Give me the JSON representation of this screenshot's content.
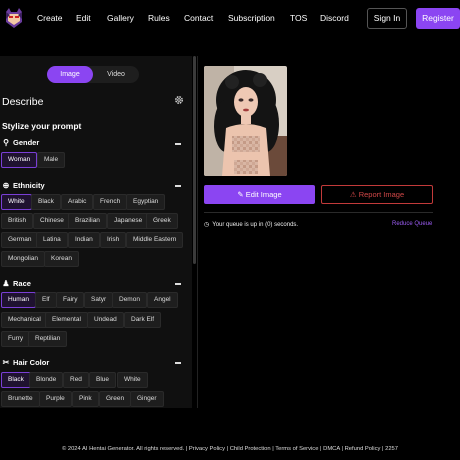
{
  "nav": {
    "links": [
      "Create",
      "Edit",
      "Gallery",
      "Rules",
      "Contact",
      "Subscription",
      "TOS",
      "Discord"
    ],
    "signin": "Sign In",
    "register": "Register"
  },
  "mode_toggle": {
    "image": "Image",
    "video": "Video"
  },
  "panel": {
    "title": "Describe",
    "subtitle": "Stylize your prompt"
  },
  "sections": {
    "gender": {
      "title": "Gender",
      "options": [
        "Woman",
        "Male"
      ],
      "selected": "Woman"
    },
    "ethnicity": {
      "title": "Ethnicity",
      "options": [
        "White",
        "Black",
        "Arabic",
        "French",
        "Egyptian",
        "British",
        "Chinese",
        "Brazilian",
        "Japanese",
        "Greek",
        "German",
        "Latina",
        "Indian",
        "Irish",
        "Middle Eastern",
        "Mongolian",
        "Korean"
      ],
      "selected": "White"
    },
    "race": {
      "title": "Race",
      "options": [
        "Human",
        "Elf",
        "Fairy",
        "Satyr",
        "Demon",
        "Angel",
        "Mechanical",
        "Elemental",
        "Undead",
        "Dark Elf",
        "Furry",
        "Reptilian"
      ],
      "selected": "Human"
    },
    "hair_color": {
      "title": "Hair Color",
      "options": [
        "Black",
        "Blonde",
        "Red",
        "Blue",
        "White",
        "Brunette",
        "Purple",
        "Pink",
        "Green",
        "Ginger"
      ],
      "selected": "Black"
    }
  },
  "actions": {
    "edit": "Edit Image",
    "report": "Report Image"
  },
  "queue": {
    "message": "Your queue is up in (0) seconds.",
    "reduce": "Reduce Queue"
  },
  "footer": "© 2024 AI Hentai Generator. All rights reserved. | Privacy Policy | Child Protection | Terms of Service | DMCA | Refund Policy | 2257",
  "colors": {
    "accent": "#8b45f2",
    "danger": "#d24848",
    "panel": "#101010",
    "chip": "#1e1e1e"
  }
}
